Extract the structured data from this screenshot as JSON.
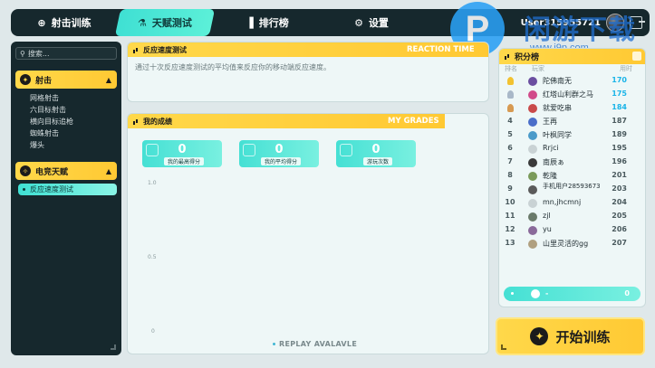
{
  "topnav": {
    "tabs": [
      {
        "label": "射击训练",
        "icon": "target-icon"
      },
      {
        "label": "天赋测试",
        "icon": "flask-icon"
      },
      {
        "label": "排行榜",
        "icon": "leaderboard-icon"
      },
      {
        "label": "设置",
        "icon": "gear-icon"
      }
    ],
    "username": "User315955721"
  },
  "watermark": {
    "brand": "P",
    "text": "闲游下载",
    "url": "www.j9p.com"
  },
  "sidebar": {
    "search_placeholder": "搜索...",
    "groups": [
      {
        "label": "射击",
        "items": [
          "网格射击",
          "六目标射击",
          "横向目标追枪",
          "蜘蛛射击",
          "爆头"
        ]
      },
      {
        "label": "电竞天赋",
        "items": [
          "反应速度测试"
        ]
      }
    ]
  },
  "reaction_card": {
    "title": "反应速度测试",
    "title_en": "REACTION TIME",
    "description": "通过十次反应速度测试的平均值来反应你的移动端反应速度。"
  },
  "grades_card": {
    "title": "我的成绩",
    "title_en": "MY GRADES",
    "stats": [
      {
        "value": "0",
        "label": "我的最高得分"
      },
      {
        "value": "0",
        "label": "我的平均得分"
      },
      {
        "value": "0",
        "label": "游玩次数"
      }
    ],
    "axis": [
      "1.0",
      "0.5",
      "0"
    ],
    "replay_label": "REPLAY AVALAVLE"
  },
  "leaderboard": {
    "title": "积分榜",
    "columns": {
      "rank": "排名",
      "player": "玩家",
      "time": "用时"
    },
    "rows": [
      {
        "rank": "1",
        "name": "陀佛南无",
        "score": "170",
        "medal": "#f2c230",
        "avatar": "#6a4ea0"
      },
      {
        "rank": "2",
        "name": "红塔山利群之马",
        "score": "175",
        "medal": "#a9b8c8",
        "avatar": "#d14a8a"
      },
      {
        "rank": "3",
        "name": "就爱吃串",
        "score": "184",
        "medal": "#d79a52",
        "avatar": "#c94a4a"
      },
      {
        "rank": "4",
        "name": "王再",
        "score": "187",
        "avatar": "#4a6ec9"
      },
      {
        "rank": "5",
        "name": "叶枫同学",
        "score": "189",
        "avatar": "#4a9ac9"
      },
      {
        "rank": "6",
        "name": "Rrjci",
        "score": "195",
        "avatar": "#c9d2d4"
      },
      {
        "rank": "7",
        "name": "南辰ぁ",
        "score": "196",
        "avatar": "#3a3a3a"
      },
      {
        "rank": "8",
        "name": "乾隆",
        "score": "201",
        "avatar": "#7a9a5a"
      },
      {
        "rank": "9",
        "name": "手机用户28593673",
        "score": "203",
        "avatar": "#5a5a5a"
      },
      {
        "rank": "10",
        "name": "mn,jhcmnj",
        "score": "204",
        "avatar": "#c9d2d4"
      },
      {
        "rank": "11",
        "name": "zjl",
        "score": "205",
        "avatar": "#6a7a6a"
      },
      {
        "rank": "12",
        "name": "yu",
        "score": "206",
        "avatar": "#8a6a9a"
      },
      {
        "rank": "13",
        "name": "山里灵活的gg",
        "score": "207",
        "avatar": "#b0a080"
      }
    ],
    "self": {
      "name": "-",
      "score": "0"
    }
  },
  "start_button": {
    "label": "开始训练"
  }
}
